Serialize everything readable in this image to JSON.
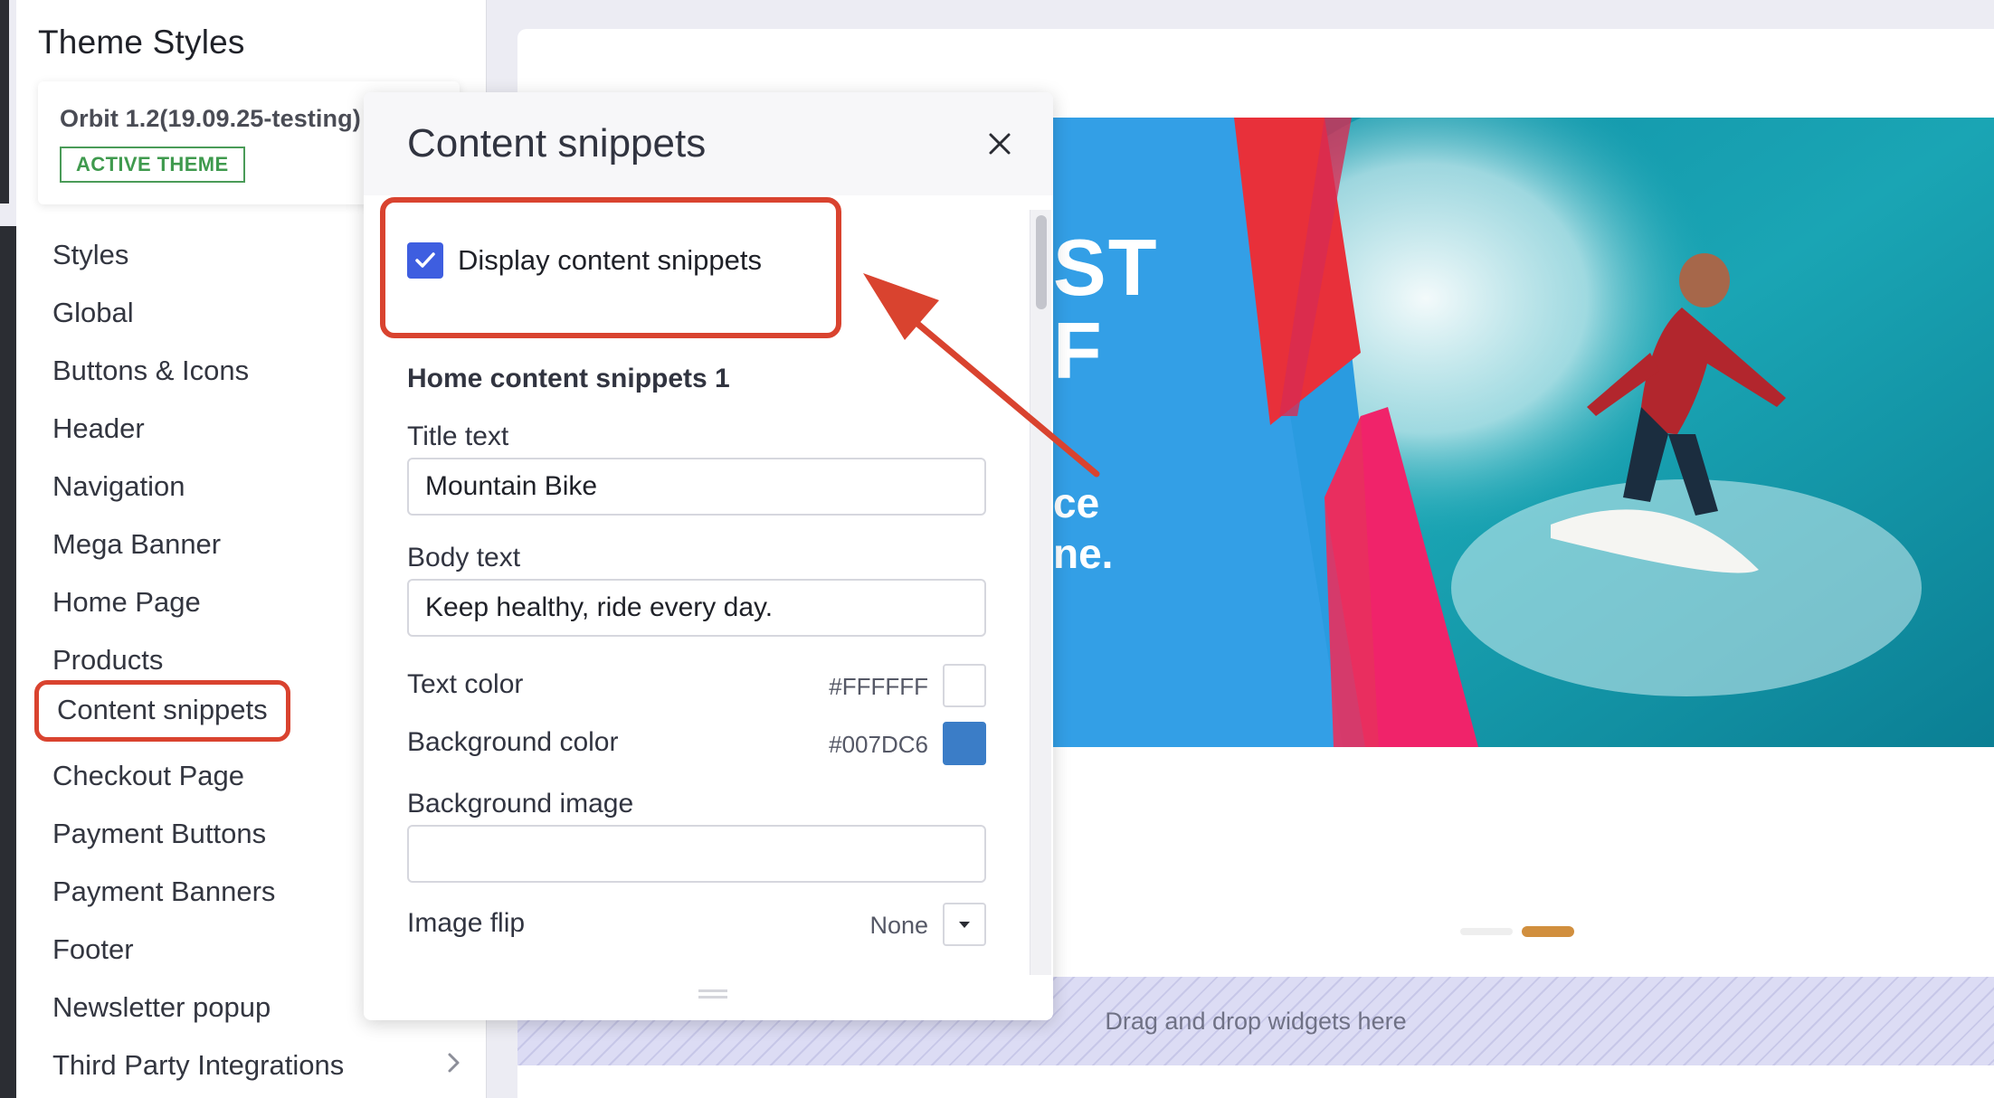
{
  "sidebar": {
    "title": "Theme Styles",
    "theme": {
      "name": "Orbit 1.2(19.09.25-testing)",
      "badge": "ACTIVE THEME"
    },
    "items": [
      {
        "label": "Styles"
      },
      {
        "label": "Global"
      },
      {
        "label": "Buttons & Icons"
      },
      {
        "label": "Header"
      },
      {
        "label": "Navigation"
      },
      {
        "label": "Mega Banner"
      },
      {
        "label": "Home Page"
      },
      {
        "label": "Products"
      },
      {
        "label": "Content snippets",
        "highlighted": true
      },
      {
        "label": "Checkout Page"
      },
      {
        "label": "Payment Buttons"
      },
      {
        "label": "Payment Banners"
      },
      {
        "label": "Footer"
      },
      {
        "label": "Newsletter popup"
      },
      {
        "label": "Third Party Integrations",
        "icon": "chevron-right-icon"
      }
    ]
  },
  "panel": {
    "title": "Content snippets",
    "close_icon": "close-icon",
    "display_checkbox": {
      "label": "Display content snippets",
      "checked": true
    },
    "section_title": "Home content snippets 1",
    "title_text": {
      "label": "Title text",
      "value": "Mountain Bike"
    },
    "body_text": {
      "label": "Body text",
      "value": "Keep healthy, ride every day."
    },
    "text_color": {
      "label": "Text color",
      "hex": "#FFFFFF",
      "color": "#FFFFFF"
    },
    "background_color": {
      "label": "Background color",
      "hex": "#007DC6",
      "color": "#3b7dc7"
    },
    "background_image": {
      "label": "Background image",
      "value": ""
    },
    "image_flip": {
      "label": "Image flip",
      "value": "None"
    }
  },
  "preview": {
    "banner_text_1": "ST\nF",
    "banner_text_2": "ce\nne.",
    "dropzone_text": "Drag and drop widgets here",
    "slider_active_index": 1
  },
  "colors": {
    "annotation_red": "#d9432f",
    "checkbox_blue": "#3e5ee0",
    "active_badge_green": "#3f9a4e",
    "slider_active": "#d18f3e"
  }
}
